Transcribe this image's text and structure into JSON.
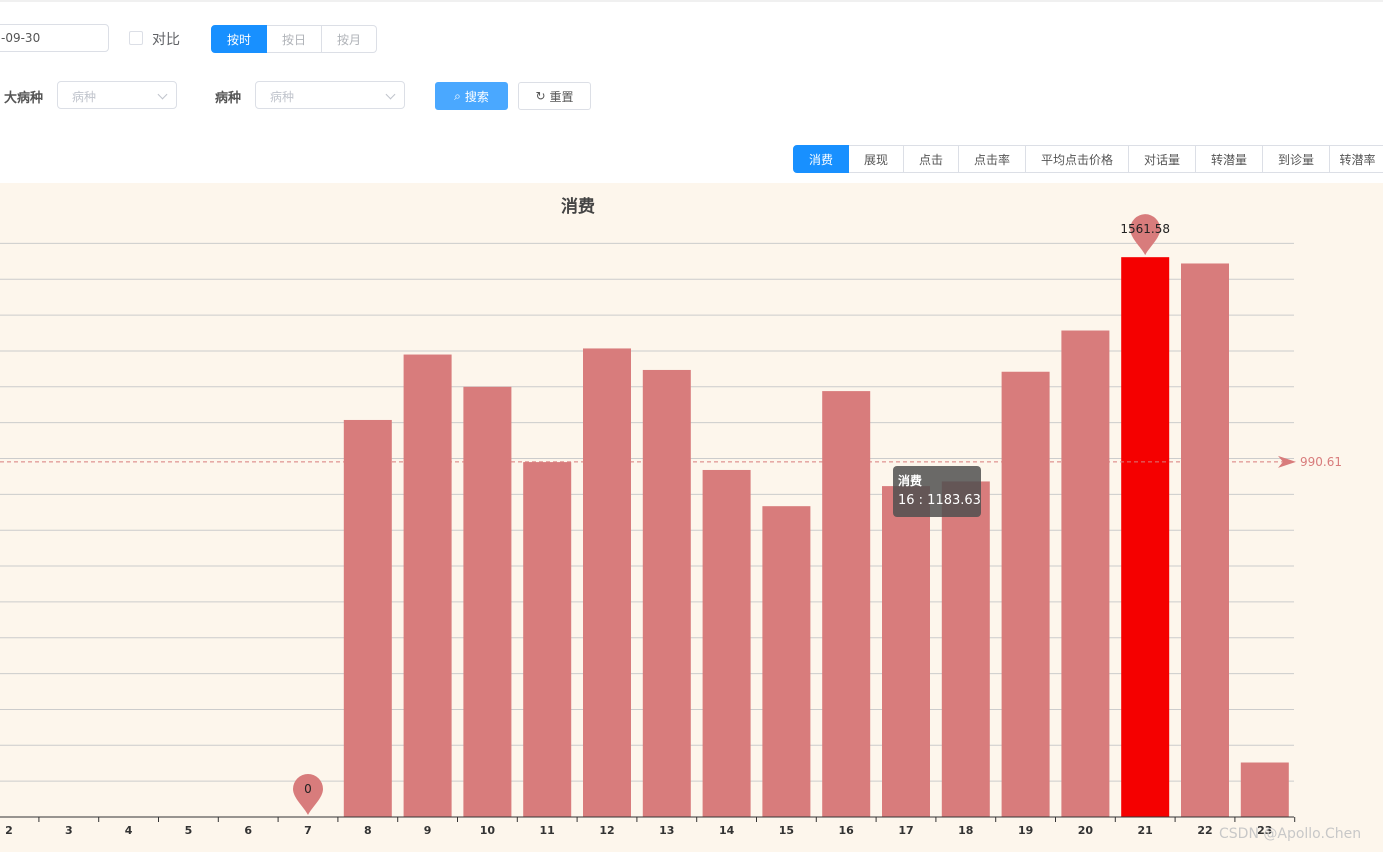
{
  "filters": {
    "date_value": "-09-30",
    "compare_label": "对比",
    "granularity": [
      "按时",
      "按日",
      "按月"
    ],
    "granularity_active": 0,
    "major_disease_label": "大病种",
    "major_disease_placeholder": "病种",
    "disease_label": "病种",
    "disease_placeholder": "病种",
    "search_label": "搜索",
    "reset_label": "重置"
  },
  "metrics": {
    "tabs": [
      "消费",
      "展现",
      "点击",
      "点击率",
      "平均点击价格",
      "对话量",
      "转潜量",
      "到诊量",
      "转潜率"
    ],
    "active": 0
  },
  "tooltip": {
    "series": "消费",
    "text": "16 : 1183.63"
  },
  "watermark": "CSDN @Apollo.Chen",
  "colors": {
    "bar": "#d87c7c",
    "bar_highlight": "#f50000",
    "accent": "#1890ff",
    "background": "#fdf6ec"
  },
  "chart_data": {
    "type": "bar",
    "title": "消费",
    "categories": [
      "2",
      "3",
      "4",
      "5",
      "6",
      "7",
      "8",
      "9",
      "10",
      "11",
      "12",
      "13",
      "14",
      "15",
      "16",
      "17",
      "18",
      "19",
      "20",
      "21",
      "22",
      "23"
    ],
    "values": [
      0,
      0,
      0,
      0,
      0,
      0,
      1107.5,
      1290.0,
      1200.0,
      990.0,
      1307.0,
      1247.0,
      968.0,
      867.0,
      1188.0,
      923.0,
      936.0,
      1242.0,
      1357.0,
      1561.58,
      1544.0,
      152.0
    ],
    "highlight_index": 19,
    "ylim": [
      0,
      1600
    ],
    "y_gridline_step": 100,
    "mark_point_max": {
      "category": "21",
      "label": "1561.58"
    },
    "mark_point_min": {
      "category": "7",
      "label": "0"
    },
    "mark_line_average": {
      "value": 990.61,
      "label": "990.61"
    },
    "grid": true,
    "legend": "none"
  }
}
